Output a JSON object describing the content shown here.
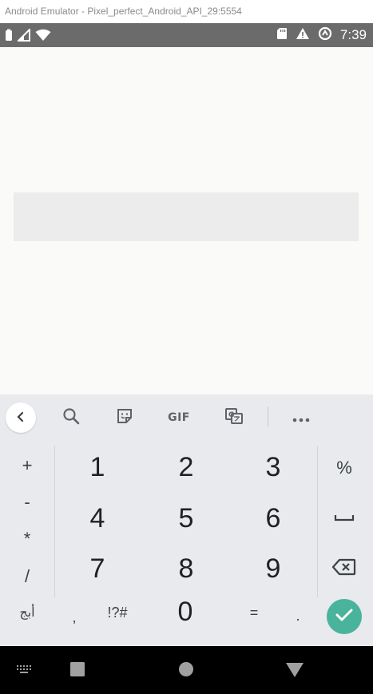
{
  "window": {
    "title": "Android Emulator - Pixel_perfect_Android_API_29:5554"
  },
  "status_bar": {
    "time": "7:39",
    "left_icons": [
      "battery-icon",
      "signal-icon",
      "wifi-icon"
    ],
    "right_icons": [
      "sd-card-icon",
      "alert-icon",
      "data-saver-icon"
    ]
  },
  "content": {
    "input_value": ""
  },
  "keyboard": {
    "toolbar": {
      "items": [
        "back-chevron-icon",
        "search-icon",
        "sticker-icon",
        "gif-button",
        "translate-icon",
        "more-icon"
      ],
      "gif_label": "GIF"
    },
    "left_column": [
      "+",
      "-",
      "*",
      "/"
    ],
    "digits": [
      [
        "1",
        "2",
        "3"
      ],
      [
        "4",
        "5",
        "6"
      ],
      [
        "7",
        "8",
        "9"
      ]
    ],
    "right_column": {
      "percent": "%"
    },
    "bottom_row": {
      "abc": "أبج",
      "comma": ",",
      "symbols": "!?#",
      "zero": "0",
      "equals": "=",
      "period": "."
    },
    "colors": {
      "accent": "#49b49b",
      "background": "#e8eaed"
    }
  },
  "nav_bar": {
    "items": [
      "keyboard-switch-icon",
      "recents-icon",
      "home-icon",
      "back-icon"
    ]
  }
}
